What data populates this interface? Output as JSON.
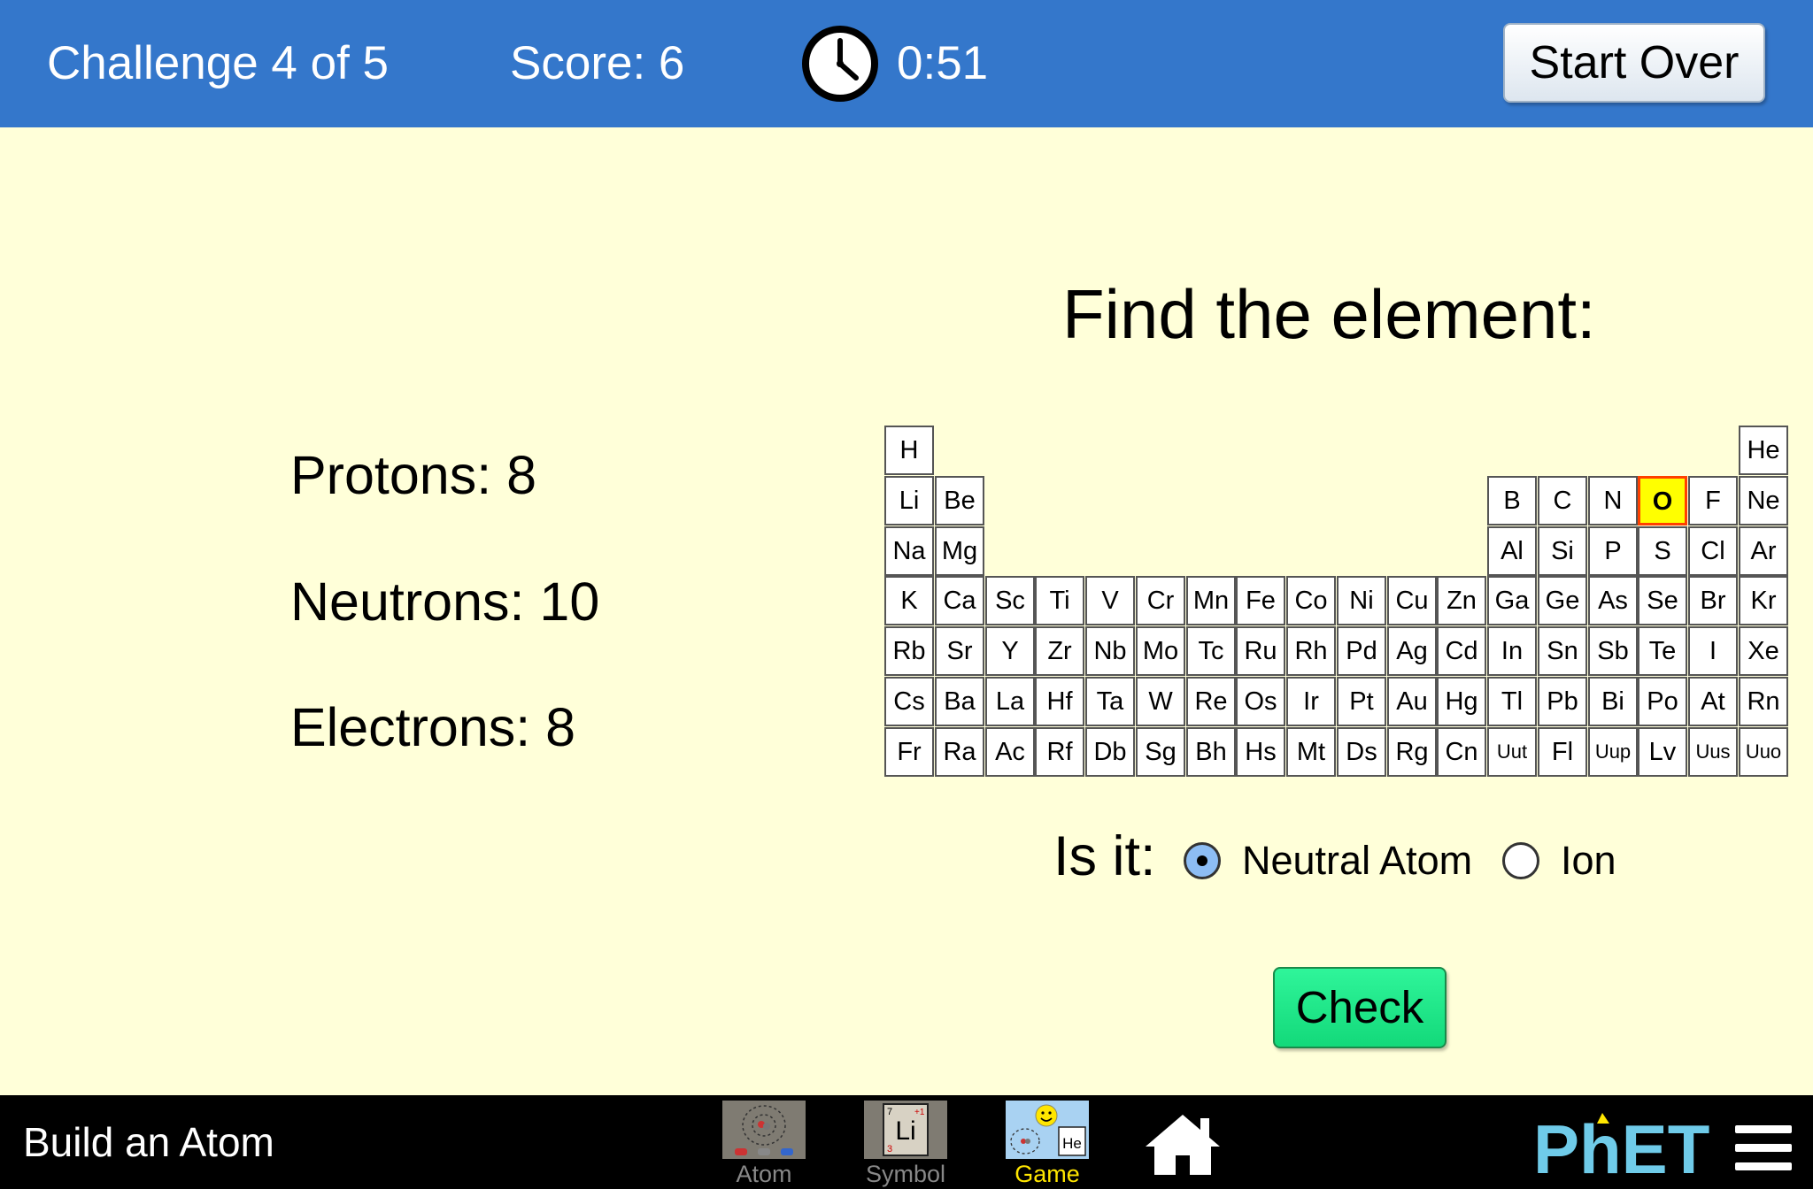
{
  "header": {
    "challenge": "Challenge 4 of 5",
    "score": "Score: 6",
    "timer": "0:51",
    "start_over_label": "Start Over",
    "bar_color": "#3477cb"
  },
  "challenge": {
    "prompt": "Find the element:",
    "protons": "Protons: 8",
    "neutrons": "Neutrons: 10",
    "electrons": "Electrons: 8"
  },
  "periodic_table": {
    "selected": "O",
    "rows": [
      [
        "H",
        "",
        "",
        "",
        "",
        "",
        "",
        "",
        "",
        "",
        "",
        "",
        "",
        "",
        "",
        "",
        "",
        "He"
      ],
      [
        "Li",
        "Be",
        "",
        "",
        "",
        "",
        "",
        "",
        "",
        "",
        "",
        "",
        "B",
        "C",
        "N",
        "O",
        "F",
        "Ne"
      ],
      [
        "Na",
        "Mg",
        "",
        "",
        "",
        "",
        "",
        "",
        "",
        "",
        "",
        "",
        "Al",
        "Si",
        "P",
        "S",
        "Cl",
        "Ar"
      ],
      [
        "K",
        "Ca",
        "Sc",
        "Ti",
        "V",
        "Cr",
        "Mn",
        "Fe",
        "Co",
        "Ni",
        "Cu",
        "Zn",
        "Ga",
        "Ge",
        "As",
        "Se",
        "Br",
        "Kr"
      ],
      [
        "Rb",
        "Sr",
        "Y",
        "Zr",
        "Nb",
        "Mo",
        "Tc",
        "Ru",
        "Rh",
        "Pd",
        "Ag",
        "Cd",
        "In",
        "Sn",
        "Sb",
        "Te",
        "I",
        "Xe"
      ],
      [
        "Cs",
        "Ba",
        "La",
        "Hf",
        "Ta",
        "W",
        "Re",
        "Os",
        "Ir",
        "Pt",
        "Au",
        "Hg",
        "Tl",
        "Pb",
        "Bi",
        "Po",
        "At",
        "Rn"
      ],
      [
        "Fr",
        "Ra",
        "Ac",
        "Rf",
        "Db",
        "Sg",
        "Bh",
        "Hs",
        "Mt",
        "Ds",
        "Rg",
        "Cn",
        "Uut",
        "Fl",
        "Uup",
        "Lv",
        "Uus",
        "Uuo"
      ]
    ]
  },
  "charge_choice": {
    "question": "Is it:",
    "options": [
      "Neutral Atom",
      "Ion"
    ],
    "selected": "Neutral Atom"
  },
  "check_label": "Check",
  "navbar": {
    "app_title": "Build an Atom",
    "screens": [
      {
        "label": "Atom",
        "icon": "atom-screen-icon",
        "active": false
      },
      {
        "label": "Symbol",
        "icon": "symbol-screen-icon",
        "active": false
      },
      {
        "label": "Game",
        "icon": "game-screen-icon",
        "active": true
      }
    ],
    "symbol_thumb": {
      "mass": "7",
      "symbol": "Li",
      "charge": "+1",
      "number": "3"
    },
    "game_thumb": {
      "symbol": "He"
    },
    "logo_text": "PhET"
  }
}
